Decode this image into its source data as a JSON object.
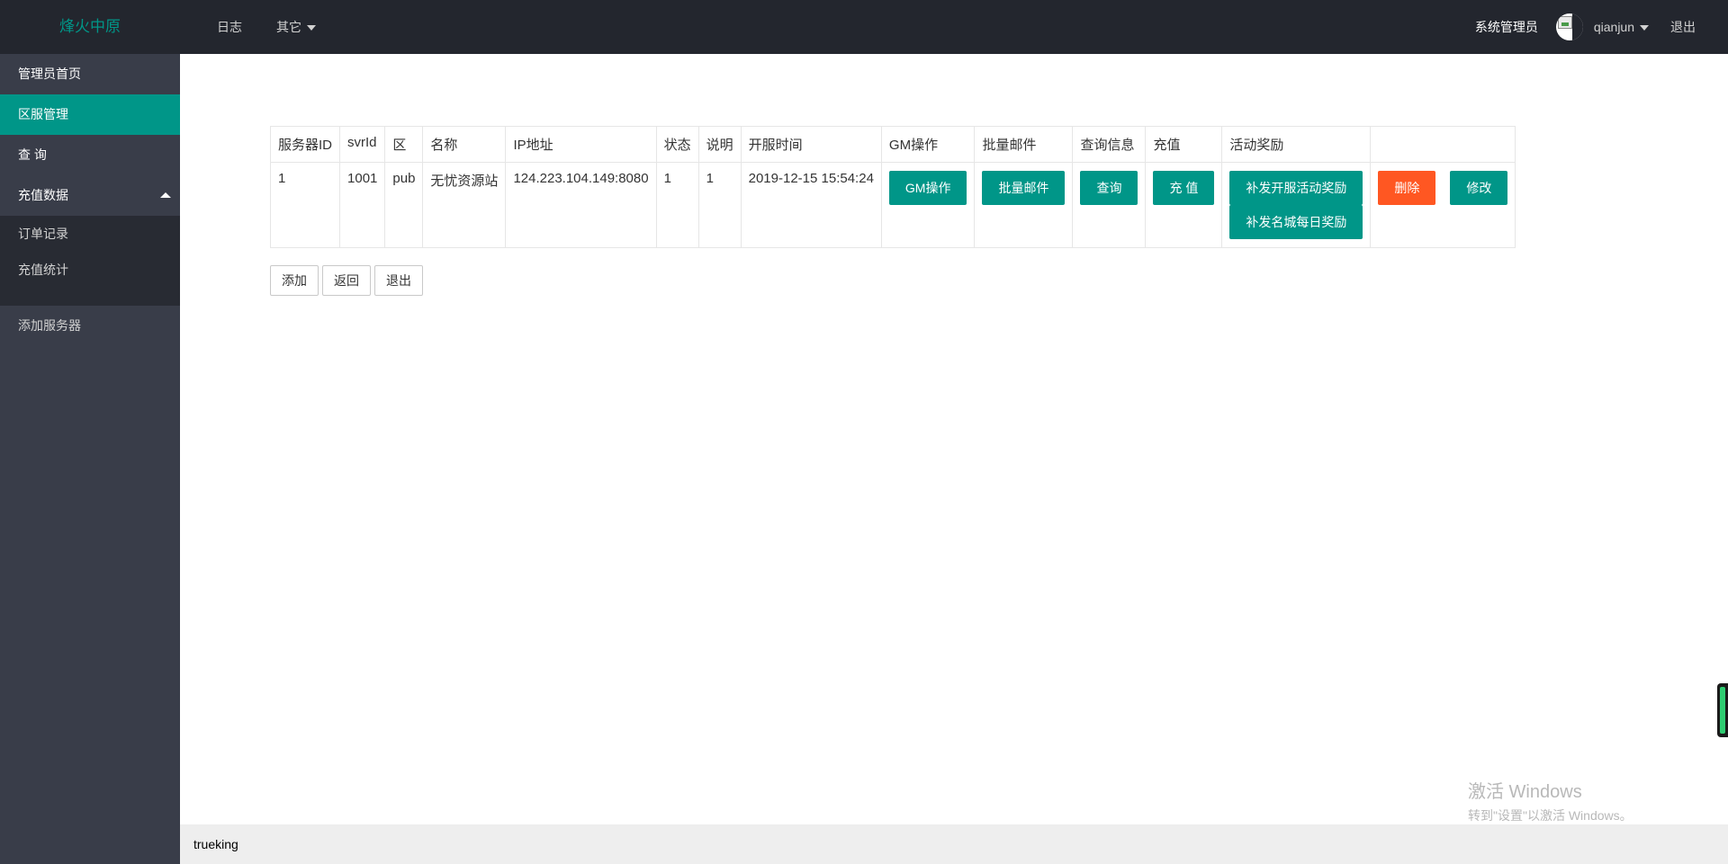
{
  "header": {
    "logo": "烽火中原",
    "nav": [
      {
        "label": "日志"
      },
      {
        "label": "其它"
      }
    ],
    "admin_label": "系统管理员",
    "username": "qianjun",
    "logout": "退出"
  },
  "sidebar": {
    "items": [
      {
        "label": "管理员首页"
      },
      {
        "label": "区服管理"
      },
      {
        "label": "查 询"
      },
      {
        "label": "充值数据"
      }
    ],
    "sub_items": [
      {
        "label": "订单记录"
      },
      {
        "label": "充值统计"
      }
    ],
    "lower_item": "添加服务器"
  },
  "table": {
    "headers": [
      "服务器ID",
      "svrId",
      "区",
      "名称",
      "IP地址",
      "状态",
      "说明",
      "开服时间",
      "GM操作",
      "批量邮件",
      "查询信息",
      "充值",
      "活动奖励",
      ""
    ],
    "row": {
      "id": "1",
      "svrid": "1001",
      "zone": "pub",
      "name": "无忧资源站",
      "ip": "124.223.104.149:8080",
      "status": "1",
      "desc": "1",
      "open_time": "2019-12-15 15:54:24",
      "gm_btn": "GM操作",
      "mail_btn": "批量邮件",
      "query_btn": "查询",
      "recharge_btn": "充 值",
      "reward_btn1": "补发开服活动奖励",
      "reward_btn2": "补发名城每日奖励",
      "delete_btn": "删除",
      "edit_btn": "修改"
    }
  },
  "actions": {
    "add": "添加",
    "back": "返回",
    "exit": "退出"
  },
  "footer": {
    "text": "trueking"
  },
  "watermark": {
    "title": "激活 Windows",
    "subtitle": "转到\"设置\"以激活 Windows。"
  },
  "colors": {
    "header_bg": "#23262e",
    "sidebar_bg": "#393d49",
    "accent": "#009688",
    "danger": "#ff5722"
  }
}
